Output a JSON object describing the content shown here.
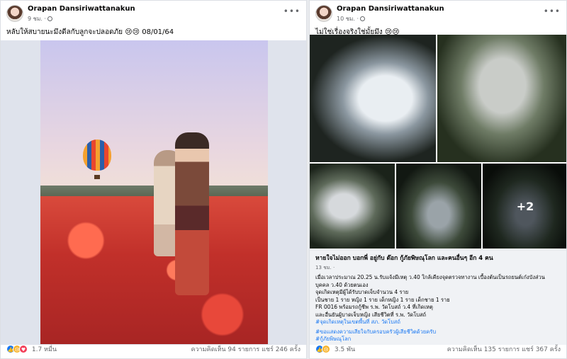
{
  "left_post": {
    "author": "Orapan Dansiriwattanakun",
    "time": "9 ชม. ·",
    "caption": "หลับให้สบายนะมึงดีลกับลูกจะปลอดภัย 😢😢 08/01/64",
    "reaction_count": "1.7 หมื่น",
    "stats": "ความคิดเห็น 94 รายการ  แชร์ 246 ครั้ง"
  },
  "right_post": {
    "author": "Orapan Dansiriwattanakun",
    "time": "10 ชม. ·",
    "caption": "ไม่ใช่เรื่องจริงใช่มั้ยมึง 😢😢",
    "more_photos": "+2",
    "card": {
      "title": "หายใจไม่ออก บอกพี่ อยู่กับ ต๊อก กู้ภัยพิษณุโลก และคนอื่นๆ อีก 4 คน",
      "time": "13 ชม. ·",
      "lines": [
        "เมื่อเวลาประมาณ 20.25 น.รับแจ้งมีเหตุ ว.40 ใกล้เคียงจุดตรวจทางาน เบื้องต้นเป็นรถยนต์เก๋งบังส่วน",
        "บุคคล ว.40 ด้วยตนเอง",
        "จุดเกิดเหตุมีผู้ได้รับบาดเจ็บจำนวน 4 ราย",
        "เป็นชาย 1 ราย หญิง 1 ราย เด็กหญิง 1 ราย เด็กชาย 1 ราย",
        "FR 0016 พร้อมรถกู้ชีพ ร.พ. วัดโบสถ์ ว.4 ที่เกิดเหตุ",
        "และอื่นยันผู้บาดเจ็บหญิง เสียชีวิตที่ ร.พ. วัดโบสถ์"
      ],
      "tags": [
        "#จุดเกิดเหตุในเขตพื้นที่ สภ. วัดโบสถ์",
        "#ขอแสดงความเสียใจกับครอบครัวผู้เสียชีวิตด้วยครับ",
        "#กู้ภัยพิษณุโลก"
      ]
    },
    "reaction_count": "3.5 พัน",
    "stats": "ความคิดเห็น 135 รายการ  แชร์ 367 ครั้ง"
  },
  "icons": [
    "globe-icon",
    "more-options-icon",
    "like-reaction-icon",
    "sad-reaction-icon",
    "love-reaction-icon"
  ]
}
